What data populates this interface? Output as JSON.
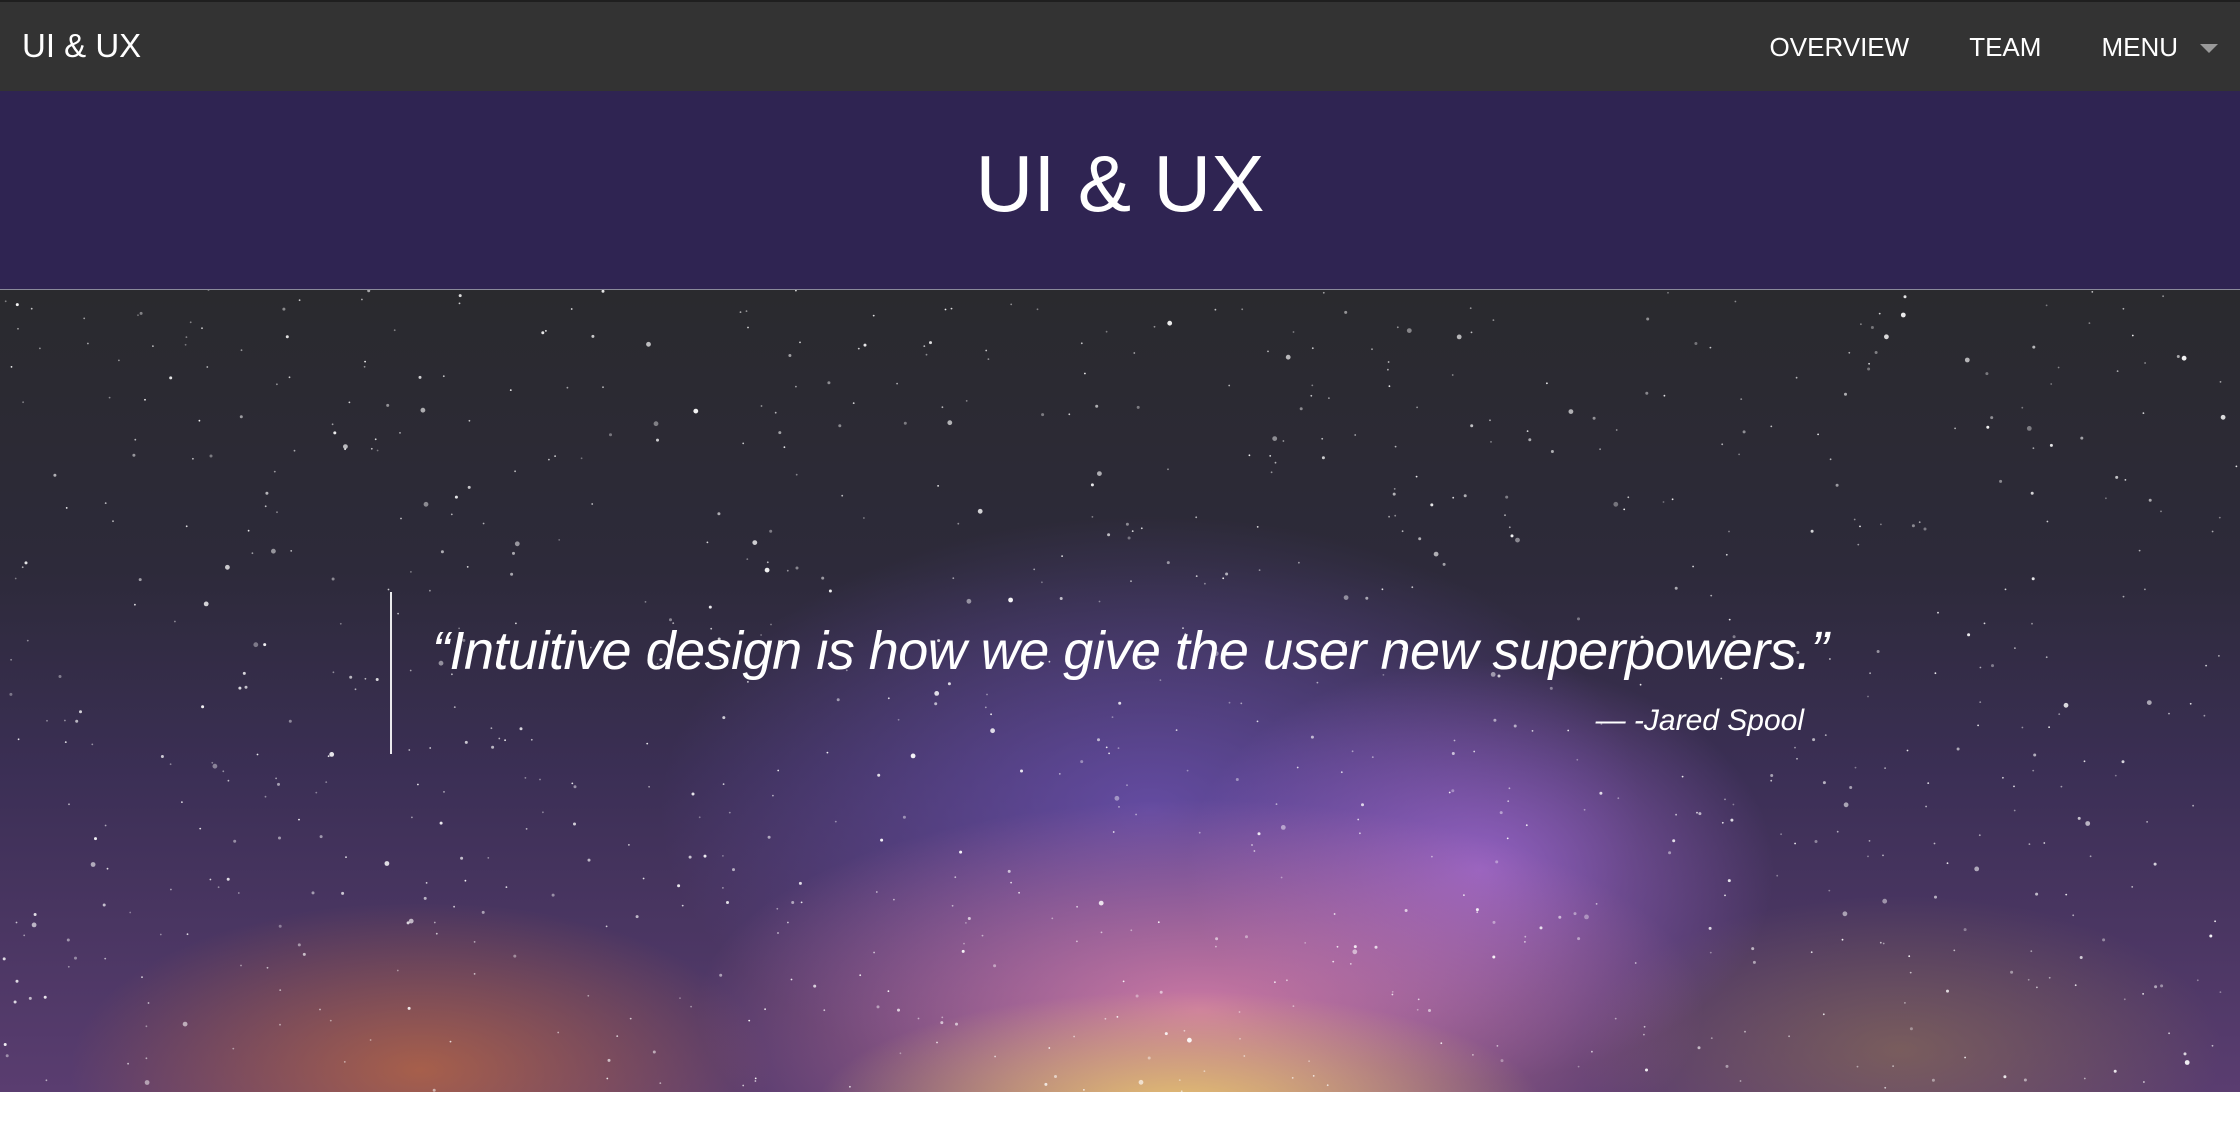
{
  "navbar": {
    "brand": "UI & UX",
    "items": [
      {
        "label": "OVERVIEW"
      },
      {
        "label": "TEAM"
      },
      {
        "label": "MENU"
      }
    ]
  },
  "header": {
    "title": "UI & UX"
  },
  "hero": {
    "quote": "“Intuitive design is how we give the user new superpowers.”",
    "author": "— -Jared Spool"
  },
  "colors": {
    "navbar_bg": "#333333",
    "title_band_bg": "#2f2452",
    "text": "#ffffff"
  }
}
